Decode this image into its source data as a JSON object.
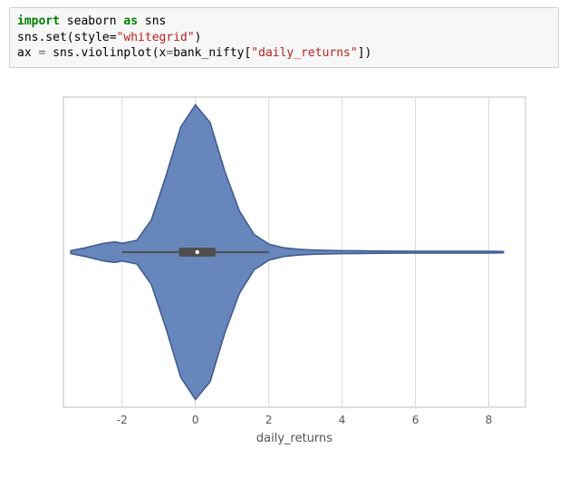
{
  "code": {
    "line1": {
      "kw": "import",
      "mod": "seaborn",
      "as": "as",
      "alias": "sns"
    },
    "line2": {
      "call": "sns.set(style=",
      "arg": "\"whitegrid\"",
      "close": ")"
    },
    "line3": {
      "lhs": "ax ",
      "eq": "=",
      "rhs": " sns.violinplot(x",
      "eq2": "=",
      "var": "bank_nifty[",
      "key": "\"daily_returns\"",
      "close": "])"
    }
  },
  "chart_data": {
    "type": "violin",
    "xlabel": "daily_returns",
    "ylabel": "",
    "xlim": [
      -3.6,
      9.0
    ],
    "x_ticks": [
      -2,
      0,
      2,
      4,
      6,
      8
    ],
    "kde": {
      "x": [
        -3.4,
        -3.0,
        -2.5,
        -2.2,
        -2.0,
        -1.6,
        -1.2,
        -0.8,
        -0.4,
        0.0,
        0.4,
        0.8,
        1.2,
        1.6,
        2.0,
        2.4,
        2.8,
        3.2,
        3.6,
        4.0,
        4.5,
        5.0,
        5.5,
        6.0,
        6.5,
        7.0,
        7.5,
        8.0,
        8.4
      ],
      "density": [
        0.01,
        0.03,
        0.06,
        0.07,
        0.06,
        0.08,
        0.22,
        0.52,
        0.85,
        1.0,
        0.88,
        0.55,
        0.28,
        0.12,
        0.055,
        0.03,
        0.02,
        0.015,
        0.012,
        0.01,
        0.009,
        0.008,
        0.007,
        0.006,
        0.006,
        0.006,
        0.006,
        0.006,
        0.005
      ]
    },
    "box": {
      "q1": -0.45,
      "median": 0.05,
      "q3": 0.55,
      "whisker_low": -2.0,
      "whisker_high": 2.0
    }
  }
}
